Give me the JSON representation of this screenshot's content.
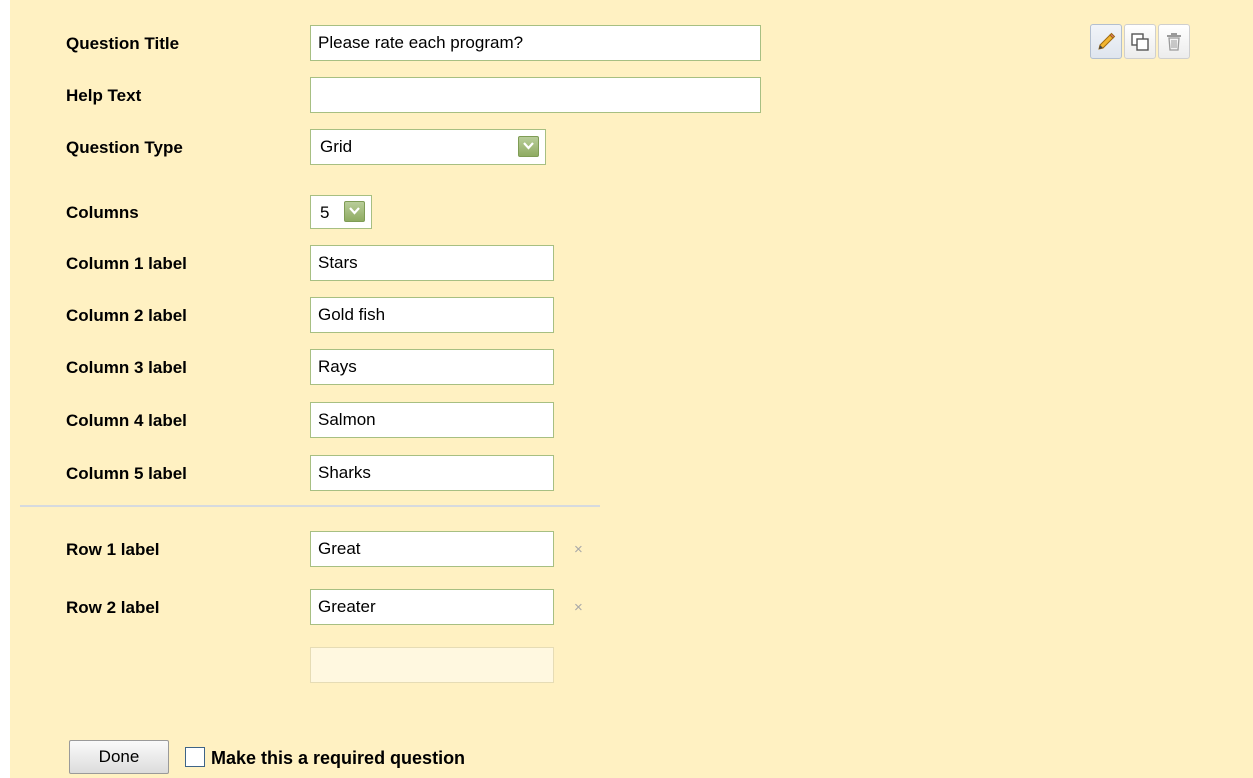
{
  "form": {
    "question_title": {
      "label": "Question Title",
      "value": "Please rate each program?"
    },
    "help_text": {
      "label": "Help Text",
      "value": ""
    },
    "question_type": {
      "label": "Question Type",
      "value": "Grid"
    },
    "columns": {
      "label": "Columns",
      "value": "5"
    },
    "column_labels": [
      {
        "label": "Column 1 label",
        "value": "Stars"
      },
      {
        "label": "Column 2 label",
        "value": "Gold fish"
      },
      {
        "label": "Column 3 label",
        "value": "Rays"
      },
      {
        "label": "Column 4 label",
        "value": "Salmon"
      },
      {
        "label": "Column 5 label",
        "value": "Sharks"
      }
    ],
    "row_labels": [
      {
        "label": "Row 1 label",
        "value": "Great",
        "remove": "×"
      },
      {
        "label": "Row 2 label",
        "value": "Greater",
        "remove": "×"
      }
    ],
    "new_row_value": ""
  },
  "toolbar": {
    "edit_icon": "pencil-icon",
    "duplicate_icon": "duplicate-icon",
    "delete_icon": "trash-icon"
  },
  "footer": {
    "done_label": "Done",
    "required_label": "Make this a required question",
    "required_checked": false
  },
  "colors": {
    "panel_background": "#fff1c2",
    "input_border": "#a7bf82",
    "dropdown_arrow": "#8fab62"
  }
}
